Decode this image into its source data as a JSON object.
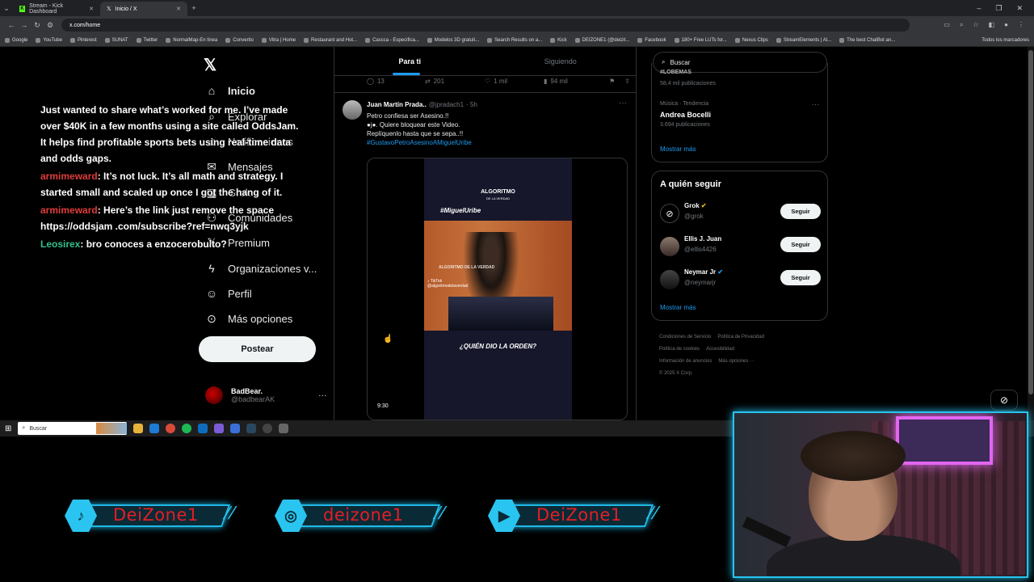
{
  "browser": {
    "tabs": [
      {
        "title": "Stream - Kick Dashboard",
        "active": false
      },
      {
        "title": "Inicio / X",
        "active": true
      }
    ],
    "url": "x.com/home",
    "bookmarks": [
      "Google",
      "YouTube",
      "Pinterest",
      "SUNAT",
      "Twitter",
      "NormalMap-En línea",
      "Convertio",
      "Vitra | Home",
      "Restaurant and Hot...",
      "Cascca - Especifica...",
      "Modelos 3D gratuit...",
      "Search Results on a...",
      "Kick",
      "DEIZONE1 (@deizit...",
      "Facebook",
      "180+ Free LUTs for...",
      "Nexus Clips",
      "StreamElements | Al...",
      "The best ChatBot an..."
    ],
    "bookmarks_all": "Todos los marcadores"
  },
  "x": {
    "nav": {
      "home": "Inicio",
      "explore": "Explorar",
      "notifications": "Notificaciones",
      "messages": "Mensajes",
      "grok": "Grok",
      "communities": "Comunidades",
      "premium": "Premium",
      "orgs": "Organizaciones v...",
      "profile": "Perfil",
      "more": "Más opciones",
      "post": "Postear"
    },
    "account": {
      "name": "BadBear.",
      "handle": "@badbearAK"
    },
    "feed_tabs": [
      "Para ti",
      "Siguiendo"
    ],
    "prev_actions": {
      "replies": "13",
      "reposts": "201",
      "likes": "1 mil",
      "views": "94 mil"
    },
    "tweet": {
      "name": "Juan Martín Prada..",
      "handle": "@jpradach1",
      "time": "· 5h",
      "line1": "Petro confiesa ser Asesino.!!",
      "line2": "●j●. Quiere bloquear este Video.",
      "line3": "Replíquenlo hasta que se sepa..!!",
      "hashtag": "#GustavoPetroAsesinoAMiguelUribe",
      "video": {
        "brand": "ALGORITMO",
        "brand_sub": "DE LA VERDAD",
        "hashtag": "#MiguelUribe",
        "watermark": "ALGORITMO DE LA VERDAD",
        "tiktok": "TikTok",
        "tiktok_handle": "@algoritmodelaverdad",
        "question": "¿QUIÉN DIO LA ORDEN?",
        "duration": "9:30"
      }
    },
    "search_placeholder": "Buscar",
    "trends": {
      "cut_title": "#LOBEMAS",
      "cut_count": "58,4 mil publicaciones",
      "category": "Música · Tendencia",
      "name": "Andrea Bocelli",
      "posts": "3.694 publicaciones",
      "show_more": "Mostrar más"
    },
    "who_to_follow": {
      "title": "A quién seguir",
      "users": [
        {
          "name": "Grok",
          "handle": "@grok",
          "button": "Seguir"
        },
        {
          "name": "Ellis J. Juan",
          "handle": "@ellis4426",
          "button": "Seguir"
        },
        {
          "name": "Neymar Jr",
          "handle": "@neymarjr",
          "button": "Seguir"
        }
      ],
      "show_more": "Mostrar más"
    },
    "footer": {
      "terms": "Condiciones de Servicio",
      "privacy": "Política de Privacidad",
      "cookies": "Política de cookies",
      "accessibility": "Accesibilidad",
      "ads": "Información de anuncios",
      "more": "Más opciones ···",
      "copyright": "© 2025 X Corp."
    }
  },
  "chat": [
    {
      "user": "",
      "text": "Just wanted to share what’s worked for me. I’ve made over $40K in a few months using a site called OddsJam. It helps find profitable sports bets using real-time data and odds gaps."
    },
    {
      "user": "armimeward",
      "text": ": It’s not luck. It’s all math and strategy. I started small and scaled up once I got the hang of it."
    },
    {
      "user": "armimeward",
      "text": ": Here’s the link just remove the space https://oddsjam .com/subscribe?ref=nwq3yjk"
    },
    {
      "user": "Leosirex",
      "text": ": bro conoces a enzocerobulto?"
    }
  ],
  "taskbar": {
    "search": "Buscar"
  },
  "socials": [
    {
      "platform": "tiktok",
      "label": "DeiZone1"
    },
    {
      "platform": "instagram",
      "label": "deizone1"
    },
    {
      "platform": "youtube",
      "label": "DeiZone1"
    }
  ],
  "colors": {
    "accent": "#1d9bf0",
    "overlay": "#27c4ef",
    "social_text": "#e41e26",
    "chat_user": "#e03c3c",
    "chat_user_alt": "#33c08b"
  }
}
